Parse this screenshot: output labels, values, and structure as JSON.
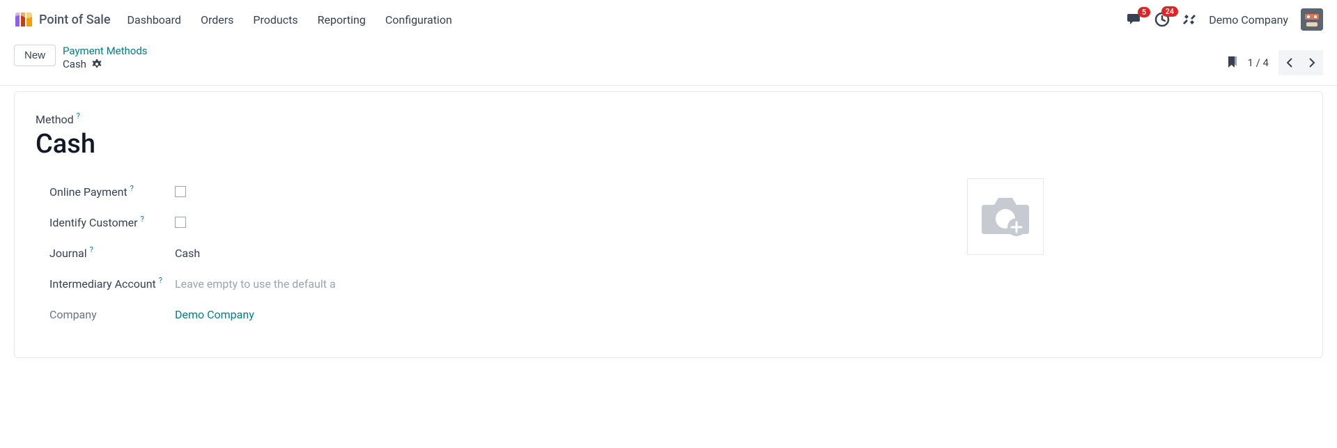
{
  "nav": {
    "app_title": "Point of Sale",
    "items": [
      "Dashboard",
      "Orders",
      "Products",
      "Reporting",
      "Configuration"
    ],
    "chat_badge": "5",
    "activity_badge": "24",
    "company": "Demo Company"
  },
  "subheader": {
    "new_label": "New",
    "breadcrumb_parent": "Payment Methods",
    "breadcrumb_current": "Cash",
    "pager": "1 / 4"
  },
  "form": {
    "method_label": "Method",
    "title": "Cash",
    "fields": {
      "online_payment": {
        "label": "Online Payment",
        "checked": false
      },
      "identify_customer": {
        "label": "Identify Customer",
        "checked": false
      },
      "journal": {
        "label": "Journal",
        "value": "Cash"
      },
      "intermediary_account": {
        "label": "Intermediary Account",
        "placeholder": "Leave empty to use the default a"
      },
      "company": {
        "label": "Company",
        "value": "Demo Company"
      }
    }
  }
}
